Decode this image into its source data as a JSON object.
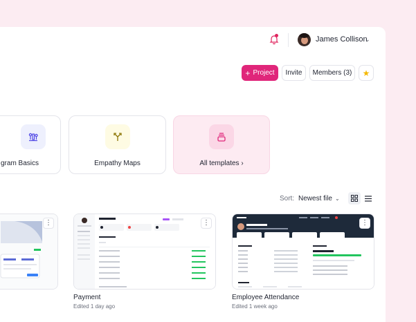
{
  "header": {
    "user_name": "James Collison",
    "icons": {
      "notifications": "bell-icon",
      "dropdown": "chevron-down-icon"
    }
  },
  "toolbar": {
    "project_label": "Project",
    "invite_label": "Invite",
    "members_label": "Members (3)",
    "star_icon": "star-icon"
  },
  "templates": [
    {
      "label": "gram Basics",
      "icon": "diagram-icon",
      "color": "#4f46e5"
    },
    {
      "label": "Empathy Maps",
      "icon": "branch-arrows-icon",
      "color": "#b59500"
    },
    {
      "label": "All templates",
      "icon": "stack-icon",
      "color": "#e0267a"
    }
  ],
  "sort": {
    "label": "Sort:",
    "value": "Newest file"
  },
  "projects": [
    {
      "title": "",
      "subtitle": ""
    },
    {
      "title": "Payment",
      "subtitle": "Edited 1 day ago"
    },
    {
      "title": "Employee Attendance",
      "subtitle": "Edited 1 week ago"
    }
  ],
  "colors": {
    "accent": "#e0267a",
    "background": "#fcecf2",
    "star": "#f5b800"
  }
}
